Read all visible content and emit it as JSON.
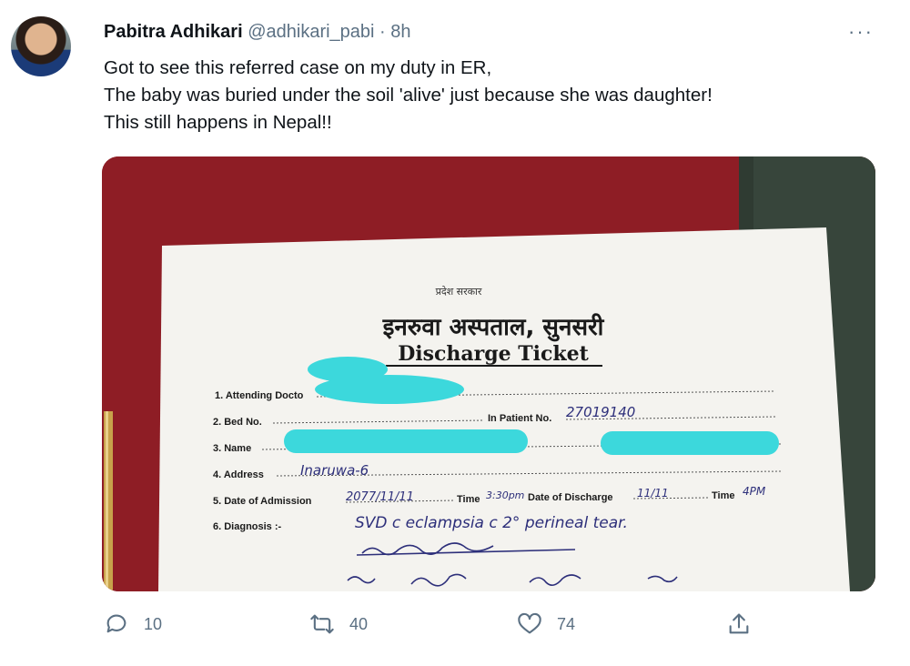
{
  "tweet": {
    "author_name": "Pabitra Adhikari",
    "handle": "@adhikari_pabi",
    "separator": "·",
    "time": "8h",
    "more_label": "···",
    "lines": [
      "Got to see this referred case on my duty in ER,",
      "The baby was buried under the soil 'alive' just because she was daughter!",
      "This still happens in Nepal!!"
    ]
  },
  "ticket": {
    "gov_header": "प्रदेश सरकार",
    "hospital": "इनरुवा अस्पताल, सुनसरी",
    "title": "Discharge Ticket",
    "labels": {
      "doctor": "1. Attending Docto",
      "bed": "2. Bed No.",
      "in_patient": "In Patient No.",
      "name": "3. Name",
      "address": "4. Address",
      "admission": "5. Date of Admission",
      "time": "Time",
      "discharge": "Date of Discharge",
      "time2": "Time",
      "diagnosis": "6. Diagnosis :-"
    },
    "handwritten": {
      "in_patient_no": "27019140",
      "address": "Inaruwa-6",
      "admission_date": "2077/11/11",
      "admission_time": "3:30pm",
      "discharge_date": "11/11",
      "discharge_time": "4PM",
      "diagnosis": "SVD c eclampsia c 2° perineal tear."
    }
  },
  "actions": {
    "reply_count": "10",
    "retweet_count": "40",
    "like_count": "74"
  }
}
